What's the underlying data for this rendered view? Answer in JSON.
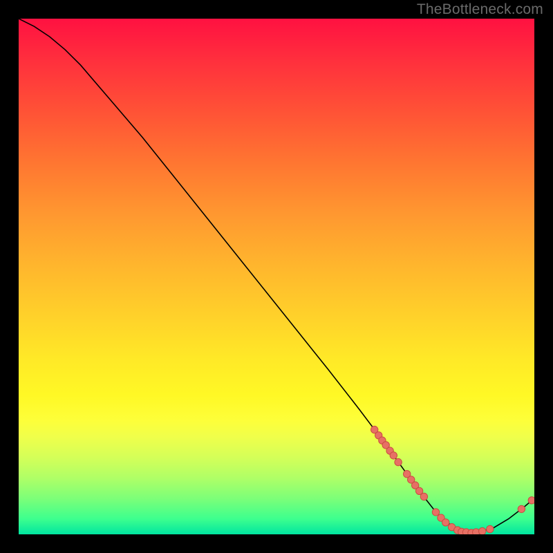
{
  "watermark": "TheBottleneck.com",
  "colors": {
    "curve": "#000000",
    "dot_fill": "#e77064",
    "dot_stroke": "#c94d42",
    "gradient_top": "#ff1141",
    "gradient_bottom": "#00e5a0",
    "background": "#000000"
  },
  "chart_data": {
    "type": "line",
    "title": "",
    "xlabel": "",
    "ylabel": "",
    "xlim": [
      0,
      100
    ],
    "ylim": [
      0,
      100
    ],
    "legend": false,
    "grid": false,
    "curve": [
      {
        "x": 0.0,
        "y": 100.0
      },
      {
        "x": 3.0,
        "y": 98.5
      },
      {
        "x": 6.0,
        "y": 96.5
      },
      {
        "x": 9.0,
        "y": 94.0
      },
      {
        "x": 12.0,
        "y": 91.0
      },
      {
        "x": 18.0,
        "y": 84.0
      },
      {
        "x": 24.0,
        "y": 77.0
      },
      {
        "x": 30.0,
        "y": 69.5
      },
      {
        "x": 36.0,
        "y": 62.0
      },
      {
        "x": 42.0,
        "y": 54.5
      },
      {
        "x": 48.0,
        "y": 47.0
      },
      {
        "x": 54.0,
        "y": 39.5
      },
      {
        "x": 60.0,
        "y": 32.0
      },
      {
        "x": 66.0,
        "y": 24.3
      },
      {
        "x": 70.0,
        "y": 19.0
      },
      {
        "x": 74.0,
        "y": 13.5
      },
      {
        "x": 78.0,
        "y": 8.0
      },
      {
        "x": 81.0,
        "y": 4.2
      },
      {
        "x": 84.0,
        "y": 1.6
      },
      {
        "x": 86.5,
        "y": 0.5
      },
      {
        "x": 89.0,
        "y": 0.4
      },
      {
        "x": 92.0,
        "y": 1.2
      },
      {
        "x": 95.0,
        "y": 3.0
      },
      {
        "x": 98.0,
        "y": 5.3
      },
      {
        "x": 100.0,
        "y": 7.0
      }
    ],
    "points": [
      {
        "x": 69.0,
        "y": 20.3
      },
      {
        "x": 69.8,
        "y": 19.2
      },
      {
        "x": 70.5,
        "y": 18.2
      },
      {
        "x": 71.2,
        "y": 17.3
      },
      {
        "x": 72.0,
        "y": 16.2
      },
      {
        "x": 72.7,
        "y": 15.3
      },
      {
        "x": 73.6,
        "y": 14.0
      },
      {
        "x": 75.3,
        "y": 11.7
      },
      {
        "x": 76.1,
        "y": 10.6
      },
      {
        "x": 76.9,
        "y": 9.5
      },
      {
        "x": 77.7,
        "y": 8.4
      },
      {
        "x": 78.6,
        "y": 7.3
      },
      {
        "x": 80.9,
        "y": 4.3
      },
      {
        "x": 81.9,
        "y": 3.2
      },
      {
        "x": 82.8,
        "y": 2.3
      },
      {
        "x": 84.0,
        "y": 1.4
      },
      {
        "x": 85.1,
        "y": 0.8
      },
      {
        "x": 85.9,
        "y": 0.5
      },
      {
        "x": 86.8,
        "y": 0.4
      },
      {
        "x": 87.8,
        "y": 0.3
      },
      {
        "x": 88.7,
        "y": 0.4
      },
      {
        "x": 89.9,
        "y": 0.6
      },
      {
        "x": 91.4,
        "y": 1.0
      },
      {
        "x": 97.5,
        "y": 4.9
      },
      {
        "x": 99.5,
        "y": 6.6
      }
    ],
    "point_radius": 5.2
  }
}
